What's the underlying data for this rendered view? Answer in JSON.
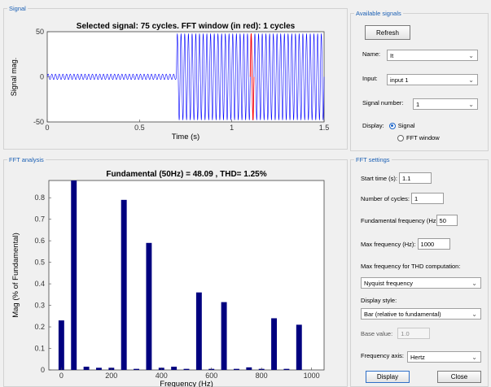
{
  "signal_panel": {
    "title": "Signal",
    "plot": {
      "title": "Selected signal: 75 cycles. FFT window (in red): 1 cycles",
      "xlabel": "Time (s)",
      "ylabel": "Signal mag."
    }
  },
  "fft_panel": {
    "title": "FFT analysis",
    "plot": {
      "title": "Fundamental (50Hz) = 48.09 , THD= 1.25%",
      "xlabel": "Frequency (Hz)",
      "ylabel": "Mag (% of Fundamental)"
    }
  },
  "available_signals": {
    "title": "Available signals",
    "refresh_label": "Refresh",
    "name_label": "Name:",
    "name_value": "It",
    "input_label": "Input:",
    "input_value": "input 1",
    "signal_number_label": "Signal number:",
    "signal_number_value": "1",
    "display_label": "Display:",
    "display_options": [
      "Signal",
      "FFT window"
    ],
    "display_selected": "Signal"
  },
  "fft_settings": {
    "title": "FFT settings",
    "start_time_label": "Start time (s):",
    "start_time_value": "1.1",
    "cycles_label": "Number of cycles:",
    "cycles_value": "1",
    "fund_freq_label": "Fundamental frequency (Hz",
    "fund_freq_value": "50",
    "max_freq_label": "Max frequency (Hz):",
    "max_freq_value": "1000",
    "thd_label": "Max frequency for THD computation:",
    "thd_value": "Nyquist frequency",
    "display_style_label": "Display style:",
    "display_style_value": "Bar (relative to fundamental)",
    "base_value_label": "Base value:",
    "base_value_value": "1.0",
    "freq_axis_label": "Frequency axis:",
    "freq_axis_value": "Hertz",
    "display_button": "Display",
    "close_button": "Close"
  },
  "chart_data": [
    {
      "type": "line",
      "title": "Selected signal: 75 cycles. FFT window (in red): 1 cycles",
      "xlabel": "Time (s)",
      "ylabel": "Signal mag.",
      "xlim": [
        0,
        1.5
      ],
      "ylim": [
        -50,
        50
      ],
      "x_ticks": [
        0,
        0.5,
        1,
        1.5
      ],
      "y_ticks": [
        -50,
        0,
        50
      ],
      "frequency_hz": 50,
      "series": [
        {
          "segment": "before",
          "x_range": [
            0,
            0.7
          ],
          "amplitude": 3,
          "color": "#0000ff"
        },
        {
          "segment": "after",
          "x_range": [
            0.7,
            1.5
          ],
          "amplitude": 48,
          "color": "#0000ff"
        }
      ],
      "fft_window": {
        "x_range": [
          1.1,
          1.12
        ],
        "color": "#ff0000"
      },
      "colors": {
        "signal": "#0000ff",
        "fft_window": "#ff0000"
      }
    },
    {
      "type": "bar",
      "title": "Fundamental (50Hz) = 48.09 , THD= 1.25%",
      "xlabel": "Frequency (Hz)",
      "ylabel": "Mag (% of Fundamental)",
      "xlim": [
        -50,
        1050
      ],
      "ylim": [
        0,
        0.88
      ],
      "x_ticks": [
        0,
        200,
        400,
        600,
        800,
        1000
      ],
      "y_ticks": [
        0,
        0.1,
        0.2,
        0.3,
        0.4,
        0.5,
        0.6,
        0.7,
        0.8
      ],
      "x": [
        0,
        50,
        100,
        150,
        200,
        250,
        300,
        350,
        400,
        450,
        500,
        550,
        600,
        650,
        700,
        750,
        800,
        850,
        900,
        950
      ],
      "values": [
        0.23,
        0.88,
        0.015,
        0.01,
        0.01,
        0.79,
        0.005,
        0.59,
        0.01,
        0.015,
        0.005,
        0.36,
        0.005,
        0.315,
        0.005,
        0.012,
        0.005,
        0.24,
        0.005,
        0.21
      ],
      "color": "#00007f"
    }
  ]
}
